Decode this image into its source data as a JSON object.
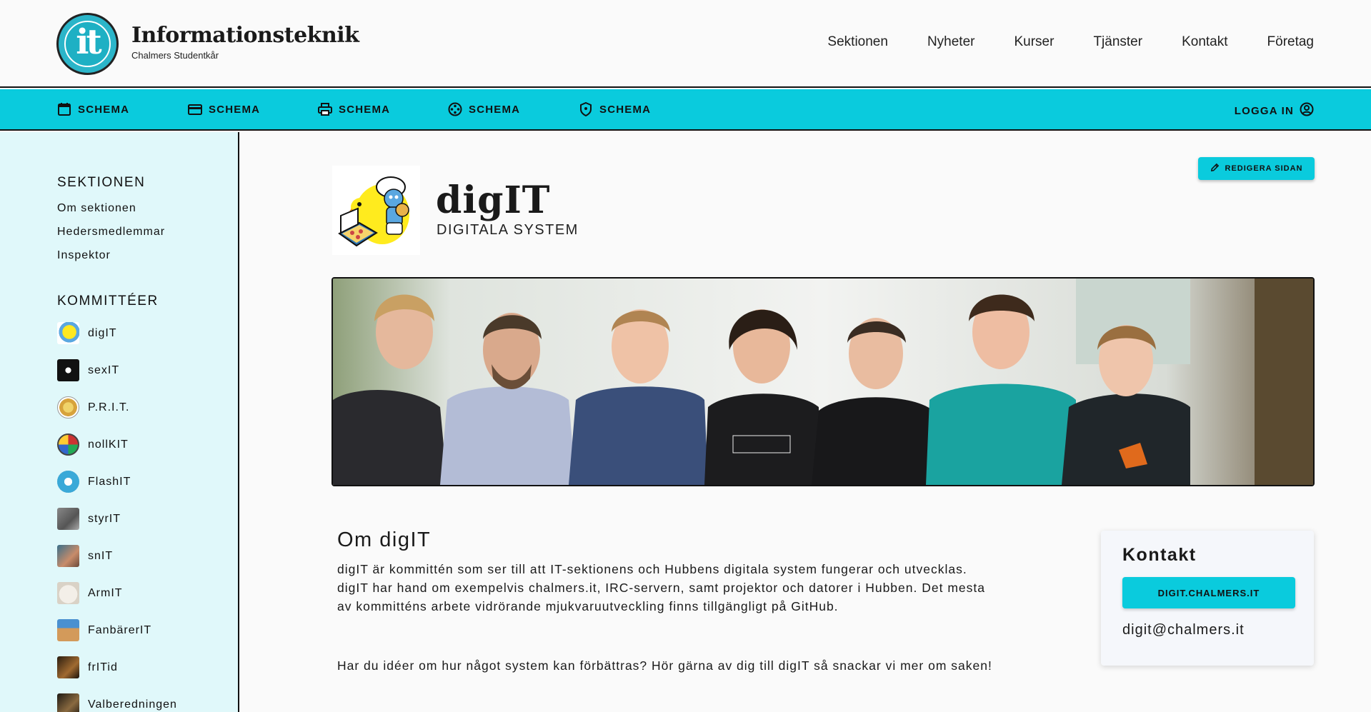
{
  "header": {
    "site_title": "Informationsteknik",
    "site_subtitle": "Chalmers Studentkår",
    "nav": [
      "Sektionen",
      "Nyheter",
      "Kurser",
      "Tjänster",
      "Kontakt",
      "Företag"
    ]
  },
  "schema_bar": {
    "items": [
      {
        "label": "SCHEMA",
        "icon": "calendar-icon"
      },
      {
        "label": "SCHEMA",
        "icon": "credit-card-icon"
      },
      {
        "label": "SCHEMA",
        "icon": "printer-icon"
      },
      {
        "label": "SCHEMA",
        "icon": "film-reel-icon"
      },
      {
        "label": "SCHEMA",
        "icon": "shield-icon"
      }
    ],
    "login_label": "LOGGA IN"
  },
  "sidebar": {
    "section_heading": "SEKTIONEN",
    "section_links": [
      "Om sektionen",
      "Hedersmedlemmar",
      "Inspektor"
    ],
    "committees_heading": "KOMMITTÉER",
    "committees": [
      "digIT",
      "sexIT",
      "P.R.I.T.",
      "nollKIT",
      "FlashIT",
      "styrIT",
      "snIT",
      "ArmIT",
      "FanbärerIT",
      "frITid",
      "Valberedningen"
    ]
  },
  "main": {
    "edit_label": "REDIGERA SIDAN",
    "committee_name": "digIT",
    "committee_subtitle": "DIGITALA SYSTEM",
    "about_title": "Om digIT",
    "about_paragraph_1": "digIT är kommittén som ser till att IT-sektionens och Hubbens digitala system fungerar och utvecklas. digIT har hand om exempelvis chalmers.it, IRC-servern, samt projektor och datorer i Hubben. Det mesta av kommitténs arbete vidrörande mjukvaruutveckling finns tillgängligt på GitHub.",
    "about_paragraph_2": "Har du idéer om hur något system kan förbättras? Hör gärna av dig till digIT så snackar vi mer om saken!"
  },
  "contact": {
    "title": "Kontakt",
    "website_button": "DIGIT.CHALMERS.IT",
    "email": "digit@chalmers.it"
  },
  "colors": {
    "accent": "#0acbdd",
    "sidebar_bg": "#e0f8fa",
    "page_bg": "#fafafa"
  }
}
